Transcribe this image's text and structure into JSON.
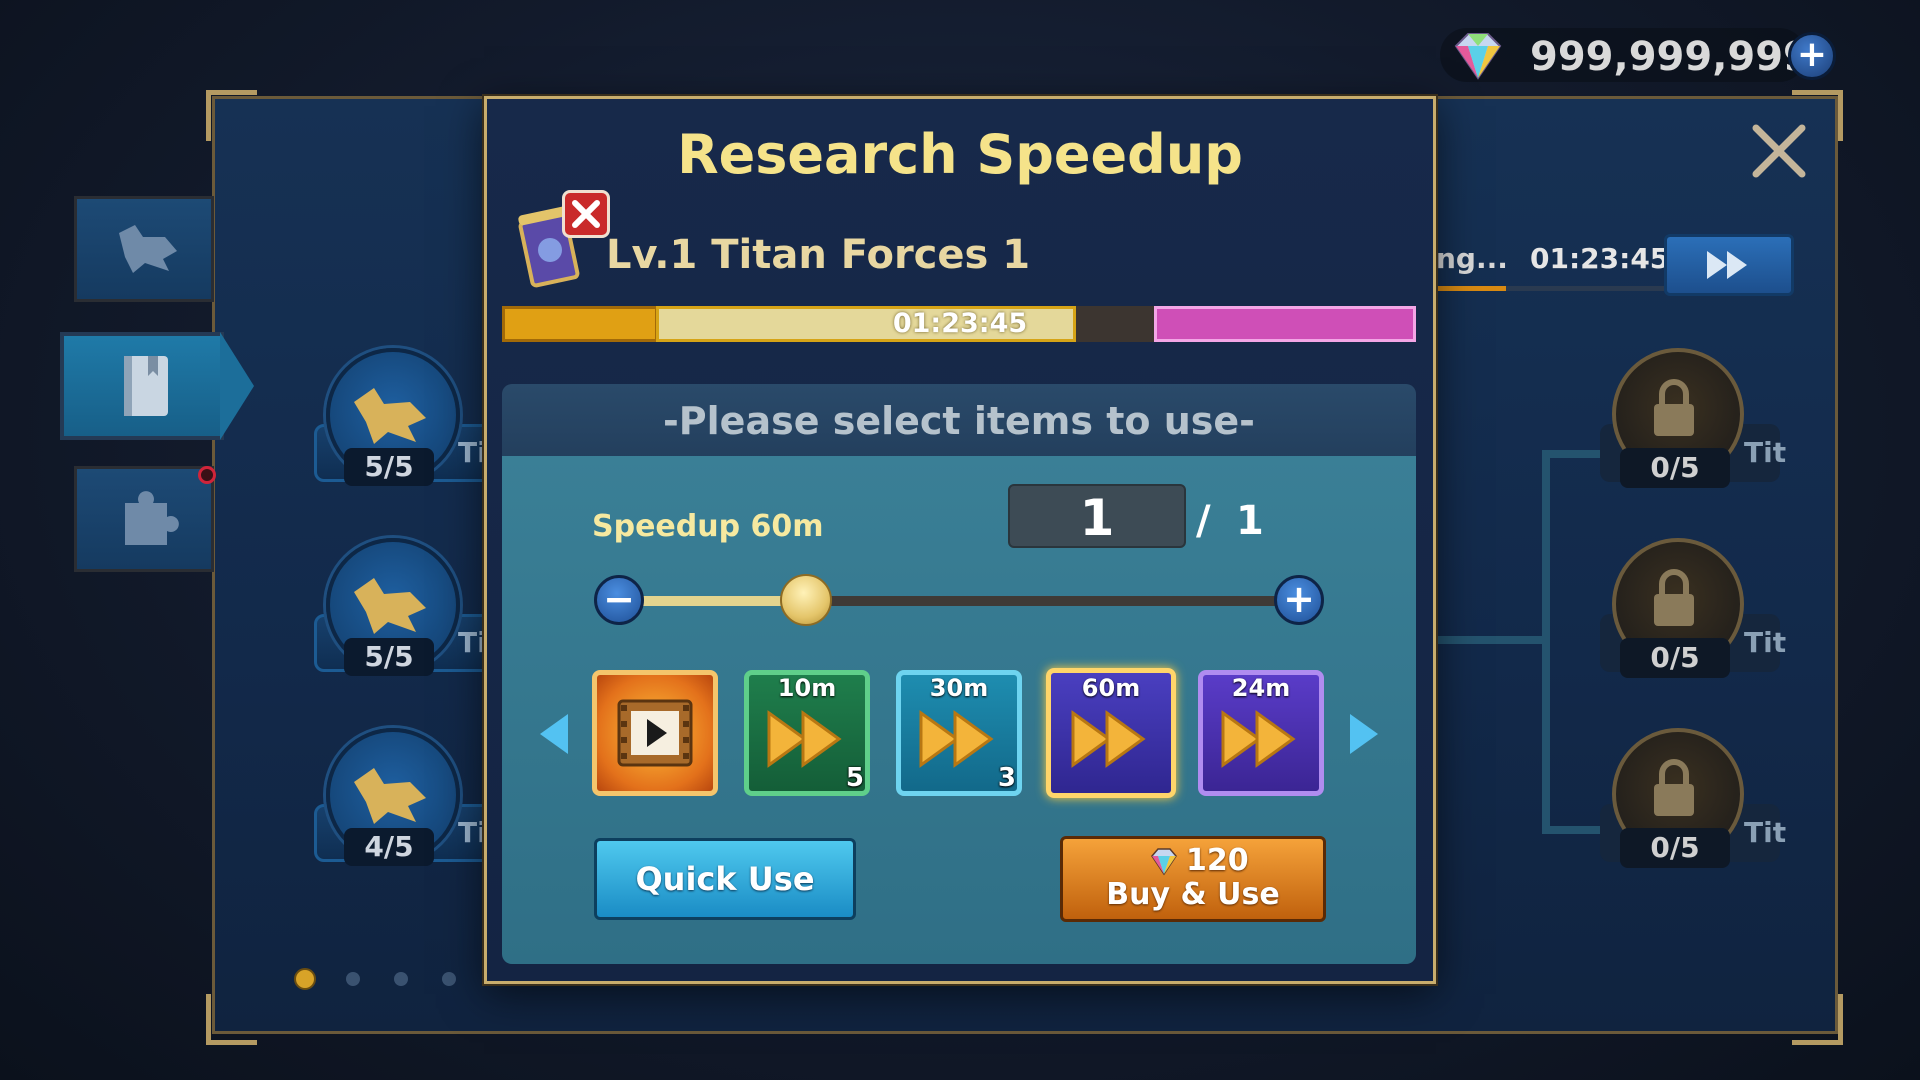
{
  "currency": {
    "value": "999,999,999",
    "icon": "gem-icon",
    "add_icon": "plus-icon"
  },
  "tabs": [
    {
      "icon": "wolf-head-icon"
    },
    {
      "icon": "book-icon"
    },
    {
      "icon": "puzzle-piece-icon"
    }
  ],
  "left_skills": [
    {
      "count": "5/5",
      "tag": "Ti"
    },
    {
      "count": "5/5",
      "tag": "Ti"
    },
    {
      "count": "4/5",
      "tag": "Ti"
    }
  ],
  "right_skills": [
    {
      "count": "0/5",
      "tag": "Tit"
    },
    {
      "count": "0/5",
      "tag": "Tit"
    },
    {
      "count": "0/5",
      "tag": "Tit"
    }
  ],
  "bg_research": {
    "label": "ng...",
    "time": "01:23:45"
  },
  "modal": {
    "title": "Research Speedup",
    "research_name": "Lv.1 Titan Forces 1",
    "progress_time": "01:23:45",
    "select_header": "-Please select items to use-",
    "speedup_label": "Speedup 60m",
    "quantity": "1",
    "slash": "/",
    "max_quantity": "1",
    "items": [
      {
        "label": "",
        "count": "",
        "icon": "video-icon"
      },
      {
        "label": "10m",
        "count": "5",
        "icon": "fast-forward-icon"
      },
      {
        "label": "30m",
        "count": "3",
        "icon": "fast-forward-icon"
      },
      {
        "label": "60m",
        "count": "",
        "icon": "fast-forward-icon"
      },
      {
        "label": "24m",
        "count": "",
        "icon": "fast-forward-icon"
      }
    ],
    "quick_use_label": "Quick Use",
    "buy_price": "120",
    "buy_label": "Buy & Use"
  },
  "colors": {
    "title": "#f5e38a",
    "progress_orange": "#e0a014",
    "progress_cream": "#e4d89a",
    "progress_pink": "#cf4fb7",
    "quick_use": "#1a8cc5",
    "buy_use": "#c0610d"
  }
}
